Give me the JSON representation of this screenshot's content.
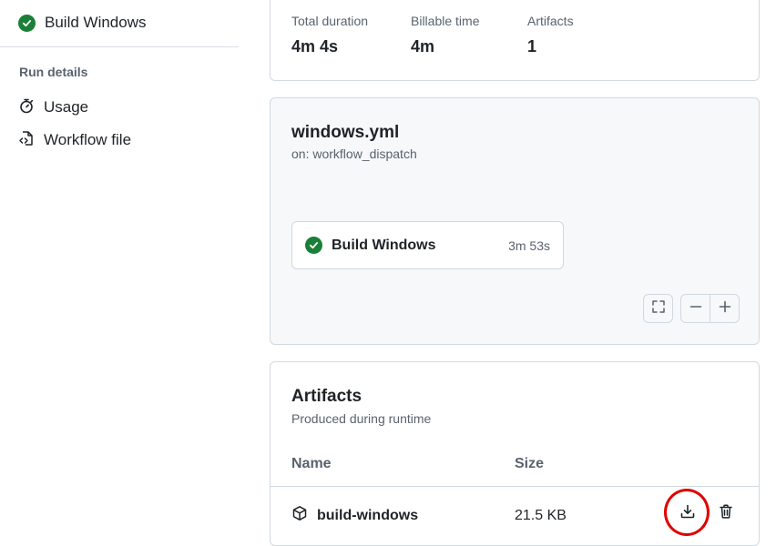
{
  "sidebar": {
    "job": {
      "label": "Build Windows",
      "status": "success"
    },
    "run_details_heading": "Run details",
    "links": [
      {
        "label": "Usage",
        "icon": "stopwatch-icon"
      },
      {
        "label": "Workflow file",
        "icon": "file-code-icon"
      }
    ]
  },
  "summary": {
    "stats": [
      {
        "label": "Total duration",
        "value": "4m 4s"
      },
      {
        "label": "Billable time",
        "value": "4m"
      },
      {
        "label": "Artifacts",
        "value": "1"
      }
    ]
  },
  "workflow": {
    "file": "windows.yml",
    "trigger": "on: workflow_dispatch",
    "job": {
      "name": "Build Windows",
      "duration": "3m 53s",
      "status": "success"
    },
    "controls": [
      "fullscreen-icon",
      "zoom-out-icon",
      "zoom-in-icon"
    ]
  },
  "artifacts": {
    "title": "Artifacts",
    "subtitle": "Produced during runtime",
    "columns": {
      "name": "Name",
      "size": "Size"
    },
    "rows": [
      {
        "name": "build-windows",
        "size": "21.5 KB"
      }
    ]
  },
  "colors": {
    "success": "#1a7f37",
    "highlight": "#e00000",
    "muted_text": "#59636e",
    "border": "#d1d9e0"
  }
}
